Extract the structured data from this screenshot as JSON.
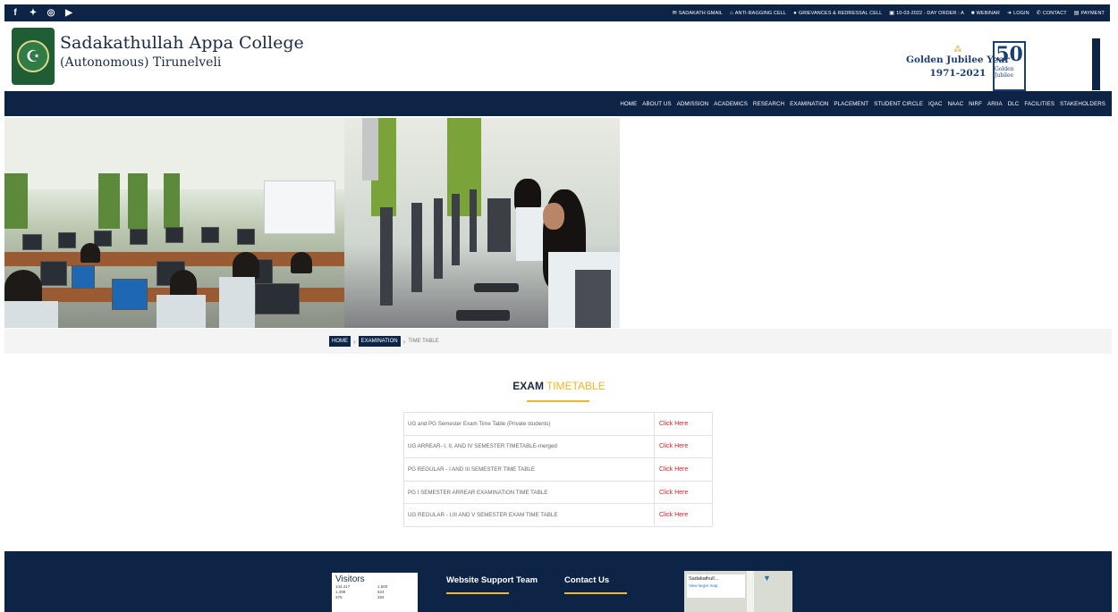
{
  "topbar": {
    "social": [
      "f",
      "t",
      "ig",
      "yt"
    ],
    "links": [
      {
        "icon": "mail-icon",
        "glyph": "✉",
        "label": "SADAKATH GMAIL"
      },
      {
        "icon": "building-icon",
        "glyph": "⌂",
        "label": "ANTI-RAGGING CELL"
      },
      {
        "icon": "pin-icon",
        "glyph": "●",
        "label": "GRIEVANCES & REDRESSAL CELL"
      },
      {
        "icon": "calendar-icon",
        "glyph": "▣",
        "label": "10-03-2022 - DAY ORDER : A"
      },
      {
        "icon": "video-icon",
        "glyph": "■",
        "label": "WEBINAR"
      },
      {
        "icon": "login-icon",
        "glyph": "➜",
        "label": "LOGIN"
      },
      {
        "icon": "phone-icon",
        "glyph": "✆",
        "label": "CONTACT"
      },
      {
        "icon": "payment-icon",
        "glyph": "▤",
        "label": "PAYMENT"
      }
    ]
  },
  "header": {
    "college_line1": "Sadakathullah Appa College",
    "college_line2": "(Autonomous) Tirunelveli",
    "jubilee_line1": "Golden Jubilee Year",
    "jubilee_line2": "1971-2021",
    "fifty_number": "50",
    "fifty_caption": "Golden Jubilee"
  },
  "nav": [
    "HOME",
    "ABOUT US",
    "ADMISSION",
    "ACADEMICS",
    "RESEARCH",
    "EXAMINATION",
    "PLACEMENT",
    "STUDENT CIRCLE",
    "IQAC",
    "NAAC",
    "NIRF",
    "ARIIA",
    "DLC",
    "FACILITIES",
    "STAKEHOLDERS"
  ],
  "breadcrumb": {
    "home": "HOME",
    "section": "EXAMINATION",
    "current": "TIME TABLE"
  },
  "page": {
    "title_main": "EXAM",
    "title_highlight": "TIMETABLE",
    "accent_color": "#f2b62d",
    "brand_color": "#0d2447"
  },
  "timetable": [
    {
      "name": "UG and PG Semester Exam Time Table (Private students)",
      "link": "Click Here"
    },
    {
      "name": "UG ARREAR- I, II, AND IV SEMESTER TIMETABLE-merged",
      "link": "Click Here"
    },
    {
      "name": "PG REGULAR - I AND III SEMESTER TIME TABLE",
      "link": "Click Here"
    },
    {
      "name": "PG I SEMESTER ARREAR EXAMINATION TIME TABLE",
      "link": "Click Here"
    },
    {
      "name": "UG REGULAR - I,III AND V SEMESTER EXAM TIME TABLE",
      "link": "Click Here"
    }
  ],
  "footer": {
    "visitors_title": "Visitors",
    "visitors": [
      "144,417",
      "1,600",
      "1,498",
      "524",
      "375",
      "284"
    ],
    "support_title": "Website Support Team",
    "contact_title": "Contact Us",
    "map_title": "Sadakathull...",
    "map_link": "View larger map"
  }
}
